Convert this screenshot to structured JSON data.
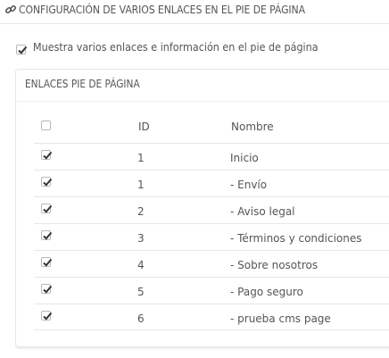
{
  "header": {
    "title": "CONFIGURACIÓN DE VARIOS ENLACES EN EL PIE DE PÁGINA",
    "icon": "link-icon"
  },
  "show_links": {
    "label": "Muestra varios enlaces e información en el pie de página",
    "checked": true
  },
  "panel": {
    "heading": "ENLACES PIE DE PÁGINA",
    "columns": {
      "select_all_checked": false,
      "id": "ID",
      "name": "Nombre"
    },
    "rows": [
      {
        "id": "1",
        "name": "Inicio",
        "checked": true
      },
      {
        "id": "1",
        "name": "- Envío",
        "checked": true
      },
      {
        "id": "2",
        "name": "- Aviso legal",
        "checked": true
      },
      {
        "id": "3",
        "name": "- Términos y condiciones",
        "checked": true
      },
      {
        "id": "4",
        "name": "- Sobre nosotros",
        "checked": true
      },
      {
        "id": "5",
        "name": "- Pago seguro",
        "checked": true
      },
      {
        "id": "6",
        "name": "- prueba cms page",
        "checked": true
      }
    ]
  },
  "colors": {
    "text": "#555555",
    "border": "#e6e6e6",
    "check": "#333333"
  }
}
